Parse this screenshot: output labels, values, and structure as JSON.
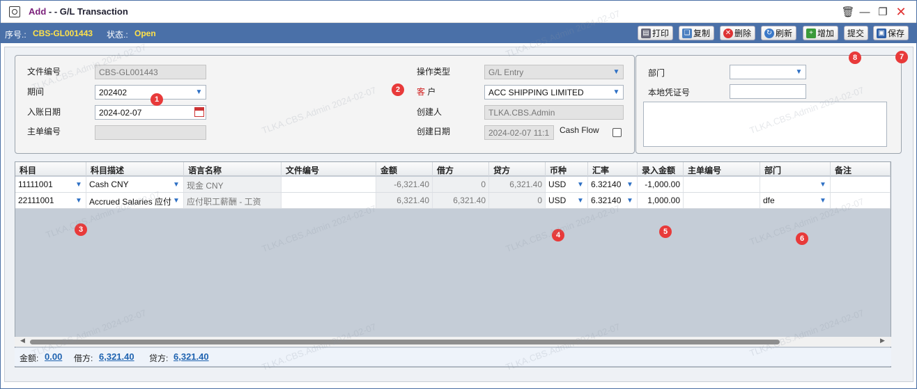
{
  "window": {
    "mode": "Add",
    "title_rest": " - - G/L Transaction"
  },
  "status": {
    "serial_label": "序号.:",
    "serial_value": "CBS-GL001443",
    "state_label": "状态.:",
    "state_value": "Open"
  },
  "toolbar": {
    "print": "打印",
    "copy": "复制",
    "delete": "删除",
    "refresh": "刷新",
    "add": "增加",
    "submit": "提交",
    "save": "保存"
  },
  "form": {
    "doc_no_label": "文件编号",
    "doc_no": "CBS-GL001443",
    "period_label": "期间",
    "period": "202402",
    "post_date_label": "入账日期",
    "post_date": "2024-02-07",
    "master_no_label": "主单编号",
    "master_no": "",
    "op_type_label": "操作类型",
    "op_type": "G/L Entry",
    "customer_label_1": "客",
    "customer_label_2": "户",
    "customer": "ACC SHIPPING LIMITED",
    "creator_label": "创建人",
    "creator": "TLKA.CBS.Admin",
    "create_date_label": "创建日期",
    "create_date": "2024-02-07 11:1",
    "cash_flow_label": "Cash Flow",
    "dept_label": "部门",
    "dept": "",
    "local_voucher_label": "本地凭证号",
    "local_voucher": ""
  },
  "grid": {
    "headers": [
      "科目",
      "科目描述",
      "语言名称",
      "文件编号",
      "金额",
      "借方",
      "贷方",
      "币种",
      "汇率",
      "录入金额",
      "主单编号",
      "部门",
      "备注"
    ],
    "rows": [
      {
        "account": "11111001",
        "desc": "Cash CNY",
        "lang_name": "现金 CNY",
        "doc_no": "",
        "amount": "-6,321.40",
        "debit": "0",
        "credit": "6,321.40",
        "currency": "USD",
        "rate": "6.32140",
        "entry_amount": "-1,000.00",
        "master_no": "",
        "dept": "",
        "remark": ""
      },
      {
        "account": "22111001",
        "desc": "Accrued Salaries 应付",
        "lang_name": "应付职工薪酬 - 工资",
        "doc_no": "",
        "amount": "6,321.40",
        "debit": "6,321.40",
        "credit": "0",
        "currency": "USD",
        "rate": "6.32140",
        "entry_amount": "1,000.00",
        "master_no": "",
        "dept": "dfe",
        "remark": ""
      }
    ]
  },
  "summary": {
    "amount_label": "金额:",
    "amount": "0.00",
    "debit_label": "借方:",
    "debit": "6,321.40",
    "credit_label": "贷方:",
    "credit": "6,321.40"
  },
  "badges": [
    "1",
    "2",
    "3",
    "4",
    "5",
    "6",
    "7",
    "8"
  ],
  "watermark": "TLKA.CBS.Admin 2024-02-07",
  "colors": {
    "status_bar": "#4a70a8",
    "status_value": "#ffe24a",
    "mode_title": "#7a1f7a",
    "badge": "#e83a3a",
    "link": "#1f63b0"
  }
}
